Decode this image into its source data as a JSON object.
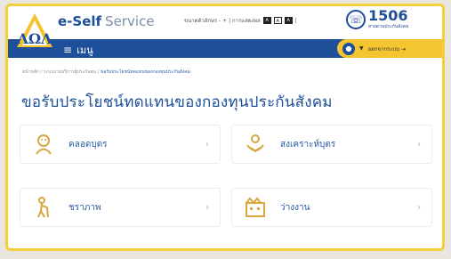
{
  "app": {
    "brand": "e-Self",
    "brand_service": "Service"
  },
  "topbar": {
    "text_size": "ขนาดตัวอักษร - + | การแสดงผล",
    "hotline_number": "1506",
    "hotline_sub": "สายด่วนประกันสังคม"
  },
  "navbar": {
    "menu_label": "เมนู",
    "logout_label": "ออกจากระบบ"
  },
  "breadcrumb": {
    "home": "หน้าหลัก",
    "section": "ระบบงานบริการผู้ประกันตน",
    "current": "ขอรับประโยชน์ทดแทนของกองทุนประกันสังคม"
  },
  "page": {
    "title": "ขอรับประโยชน์ทดแทนของกองทุนประกันสังคม"
  },
  "cards": [
    {
      "label": "คลอดบุตร",
      "icon": "baby-icon"
    },
    {
      "label": "สงเคราะห์บุตร",
      "icon": "child-allowance-icon"
    },
    {
      "label": "ชราภาพ",
      "icon": "elderly-icon"
    },
    {
      "label": "ว่างงาน",
      "icon": "unemployment-icon"
    }
  ],
  "colors": {
    "primary": "#1d4f9a",
    "accent": "#f5c531",
    "icon_gold": "#d9a640"
  }
}
